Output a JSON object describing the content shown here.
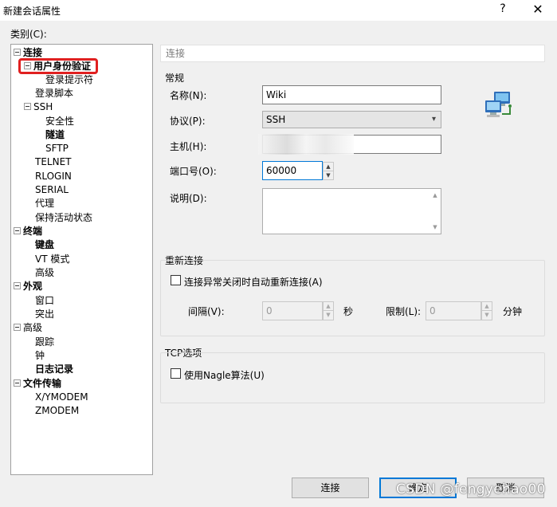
{
  "window": {
    "title": "新建会话属性",
    "help": "?",
    "close": "✕"
  },
  "category_label": "类别(C):",
  "tree": [
    {
      "label": "连接",
      "bold": true,
      "expander": true
    },
    {
      "label": "用户身份验证",
      "bold": true,
      "expander": true
    },
    {
      "label": "登录提示符",
      "bold": false,
      "expander": false
    },
    {
      "label": "登录脚本",
      "bold": false,
      "expander": false
    },
    {
      "label": "SSH",
      "bold": false,
      "expander": true
    },
    {
      "label": "安全性",
      "bold": false,
      "expander": false
    },
    {
      "label": "隧道",
      "bold": true,
      "expander": false
    },
    {
      "label": "SFTP",
      "bold": false,
      "expander": false
    },
    {
      "label": "TELNET",
      "bold": false,
      "expander": false
    },
    {
      "label": "RLOGIN",
      "bold": false,
      "expander": false
    },
    {
      "label": "SERIAL",
      "bold": false,
      "expander": false
    },
    {
      "label": "代理",
      "bold": false,
      "expander": false
    },
    {
      "label": "保持活动状态",
      "bold": false,
      "expander": false
    },
    {
      "label": "终端",
      "bold": true,
      "expander": true
    },
    {
      "label": "键盘",
      "bold": true,
      "expander": false
    },
    {
      "label": "VT 模式",
      "bold": false,
      "expander": false
    },
    {
      "label": "高级",
      "bold": false,
      "expander": false
    },
    {
      "label": "外观",
      "bold": true,
      "expander": true
    },
    {
      "label": "窗口",
      "bold": false,
      "expander": false
    },
    {
      "label": "突出",
      "bold": false,
      "expander": false
    },
    {
      "label": "高级",
      "bold": false,
      "expander": true
    },
    {
      "label": "跟踪",
      "bold": false,
      "expander": false
    },
    {
      "label": "钟",
      "bold": false,
      "expander": false
    },
    {
      "label": "日志记录",
      "bold": true,
      "expander": false
    },
    {
      "label": "文件传输",
      "bold": true,
      "expander": true
    },
    {
      "label": "X/YMODEM",
      "bold": false,
      "expander": false
    },
    {
      "label": "ZMODEM",
      "bold": false,
      "expander": false
    }
  ],
  "header": "连接",
  "general": {
    "title": "常规",
    "name_label": "名称(N):",
    "name_value": "Wiki",
    "protocol_label": "协议(P):",
    "protocol_value": "SSH",
    "host_label": "主机(H):",
    "host_value": "",
    "port_label": "端口号(O):",
    "port_value": "60000",
    "desc_label": "说明(D):",
    "desc_value": ""
  },
  "reconnect": {
    "title": "重新连接",
    "checkbox_label": "连接异常关闭时自动重新连接(A)",
    "checked": false,
    "interval_label": "间隔(V):",
    "interval_value": "0",
    "interval_unit": "秒",
    "limit_label": "限制(L):",
    "limit_value": "0",
    "limit_unit": "分钟"
  },
  "tcp": {
    "title": "TCP选项",
    "checkbox_label": "使用Nagle算法(U)",
    "checked": false
  },
  "buttons": {
    "connect": "连接",
    "ok": "确定",
    "cancel": "取消"
  },
  "watermark": "CSDN @fengyehao00",
  "icons": {
    "expander": "minus-box-icon",
    "network": "network-computers-icon"
  }
}
